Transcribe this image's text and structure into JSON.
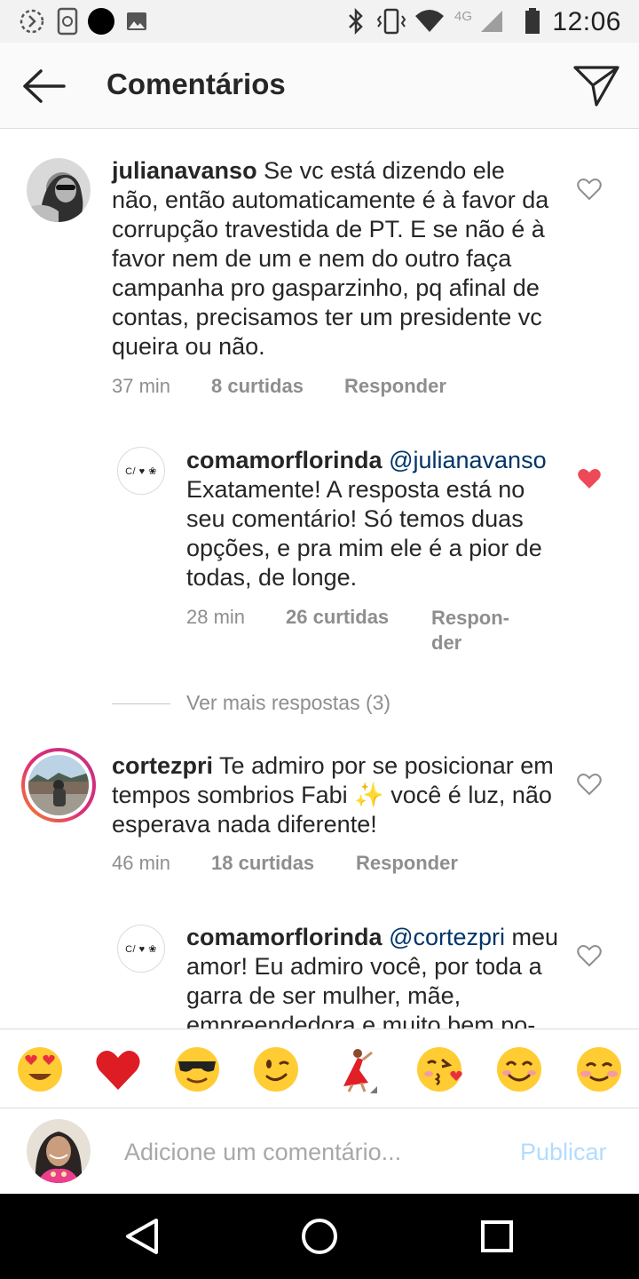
{
  "status_bar": {
    "time": "12:06",
    "network": "4G",
    "icons": [
      "sync-icon",
      "screenshot-icon",
      "circle-icon",
      "image-icon",
      "bluetooth-icon",
      "vibrate-icon",
      "wifi-icon",
      "signal-icon",
      "battery-icon"
    ]
  },
  "header": {
    "title": "Comentários",
    "back_icon": "arrow-left-icon",
    "send_icon": "paper-plane-icon"
  },
  "comments": [
    {
      "username": "julianavanso",
      "text": "Se vc está dizendo ele não,  então automaticamente é à favor da corrupção travestida de PT. E se não é à favor nem de um e nem do outro faça campanha pro gasparzinho, pq afinal de contas, precisamos ter um presidente vc queira ou não.",
      "time": "37 min",
      "likes": "8 curtidas",
      "reply": "Responder",
      "liked": false
    },
    {
      "username": "comamorflorinda",
      "mention": "@julianavanso",
      "text": "Exatamente! A resposta está no seu comentário! Só temos duas opções, e pra mim ele é a pior de todas, de longe.",
      "time": "28 min",
      "likes": "26 curtidas",
      "reply_line1": "Respon-",
      "reply_line2": "der",
      "liked": true,
      "avatar_text": "C/ ♥ ❀"
    },
    {
      "username": "cortezpri",
      "text": "Te admiro por se posicionar em tempos sombrios Fabi",
      "emoji": "✨",
      "text_after": "você é luz, não esperava nada diferente!",
      "time": "46 min",
      "likes": "18 curtidas",
      "reply": "Responder",
      "liked": false
    },
    {
      "username": "comamorflorinda",
      "mention": "@cortezpri",
      "text": "meu amor! Eu admiro você, por toda a garra de ser mulher, mãe, empreendedora e muito bem po-",
      "liked": false,
      "avatar_text": "C/ ♥ ❀"
    }
  ],
  "more_replies": "Ver mais respostas (3)",
  "emoji_bar": [
    "heart-eyes-emoji",
    "red-heart-emoji",
    "sunglasses-emoji",
    "wink-emoji",
    "dancer-emoji",
    "kiss-emoji",
    "smile-emoji",
    "blush-emoji"
  ],
  "input": {
    "placeholder": "Adicione um comentário...",
    "value": "",
    "publish_label": "Publicar"
  },
  "nav_bar": [
    "back-triangle-icon",
    "home-circle-icon",
    "recents-square-icon"
  ],
  "colors": {
    "liked_heart": "#ed4956",
    "mention": "#003569",
    "meta": "#8e8e8e",
    "publish_disabled": "#b3dbff",
    "story_ring": [
      "#f58529",
      "#dd2a7b",
      "#c13584"
    ]
  }
}
